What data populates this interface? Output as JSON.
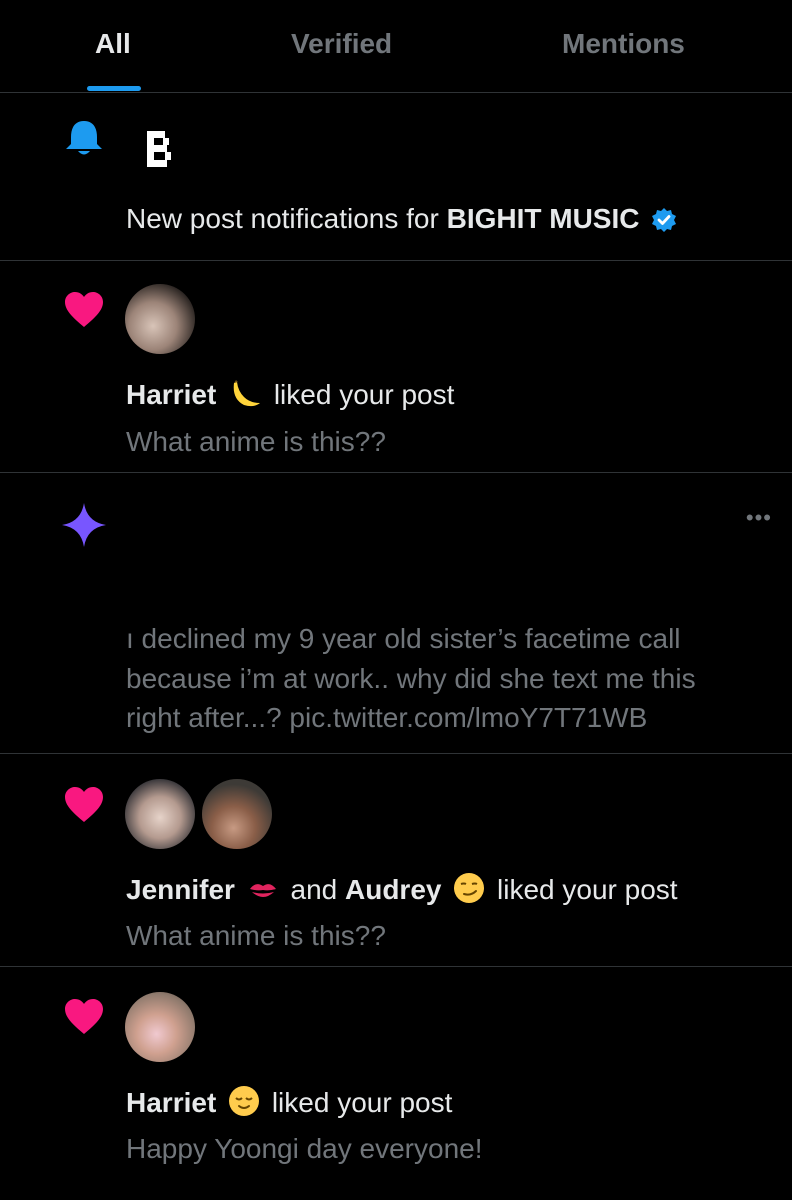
{
  "tabs": [
    {
      "label": "All",
      "active": true
    },
    {
      "label": "Verified",
      "active": false
    },
    {
      "label": "Mentions",
      "active": false
    }
  ],
  "notifications": [
    {
      "type": "post-notifications",
      "icon": "bell-icon",
      "text_prefix": "New post notifications for",
      "account": "BIGHIT MUSIC"
    },
    {
      "type": "like",
      "icon": "heart-icon",
      "users": [
        "Harriet"
      ],
      "emoji": [
        "banana-emoji"
      ],
      "action": "liked your post",
      "post": "What anime is this??"
    },
    {
      "type": "recommendation",
      "icon": "sparkle-icon",
      "more": "•••",
      "post_lines": [
        "ı declined my 9 year old sister’s facetime call",
        "because i’m at work.. why did she text me this",
        "right after...? pic.twitter.com/lmoY7T71WB"
      ]
    },
    {
      "type": "like",
      "icon": "heart-icon",
      "users": [
        "Jennifer",
        "Audrey"
      ],
      "emoji": [
        "kiss-mark-emoji",
        "smirking-face-emoji"
      ],
      "conjunction": "and",
      "action": "liked your post",
      "post": "What anime is this??"
    },
    {
      "type": "like",
      "icon": "heart-icon",
      "users": [
        "Harriet"
      ],
      "emoji": [
        "relieved-face-emoji"
      ],
      "action": "liked your post",
      "post": "Happy Yoongi day everyone!"
    }
  ],
  "colors": {
    "accent": "#1d9bf0",
    "like": "#f91880",
    "sparkle": "#7856ff",
    "muted": "#71767b",
    "divider": "#2f3336"
  }
}
